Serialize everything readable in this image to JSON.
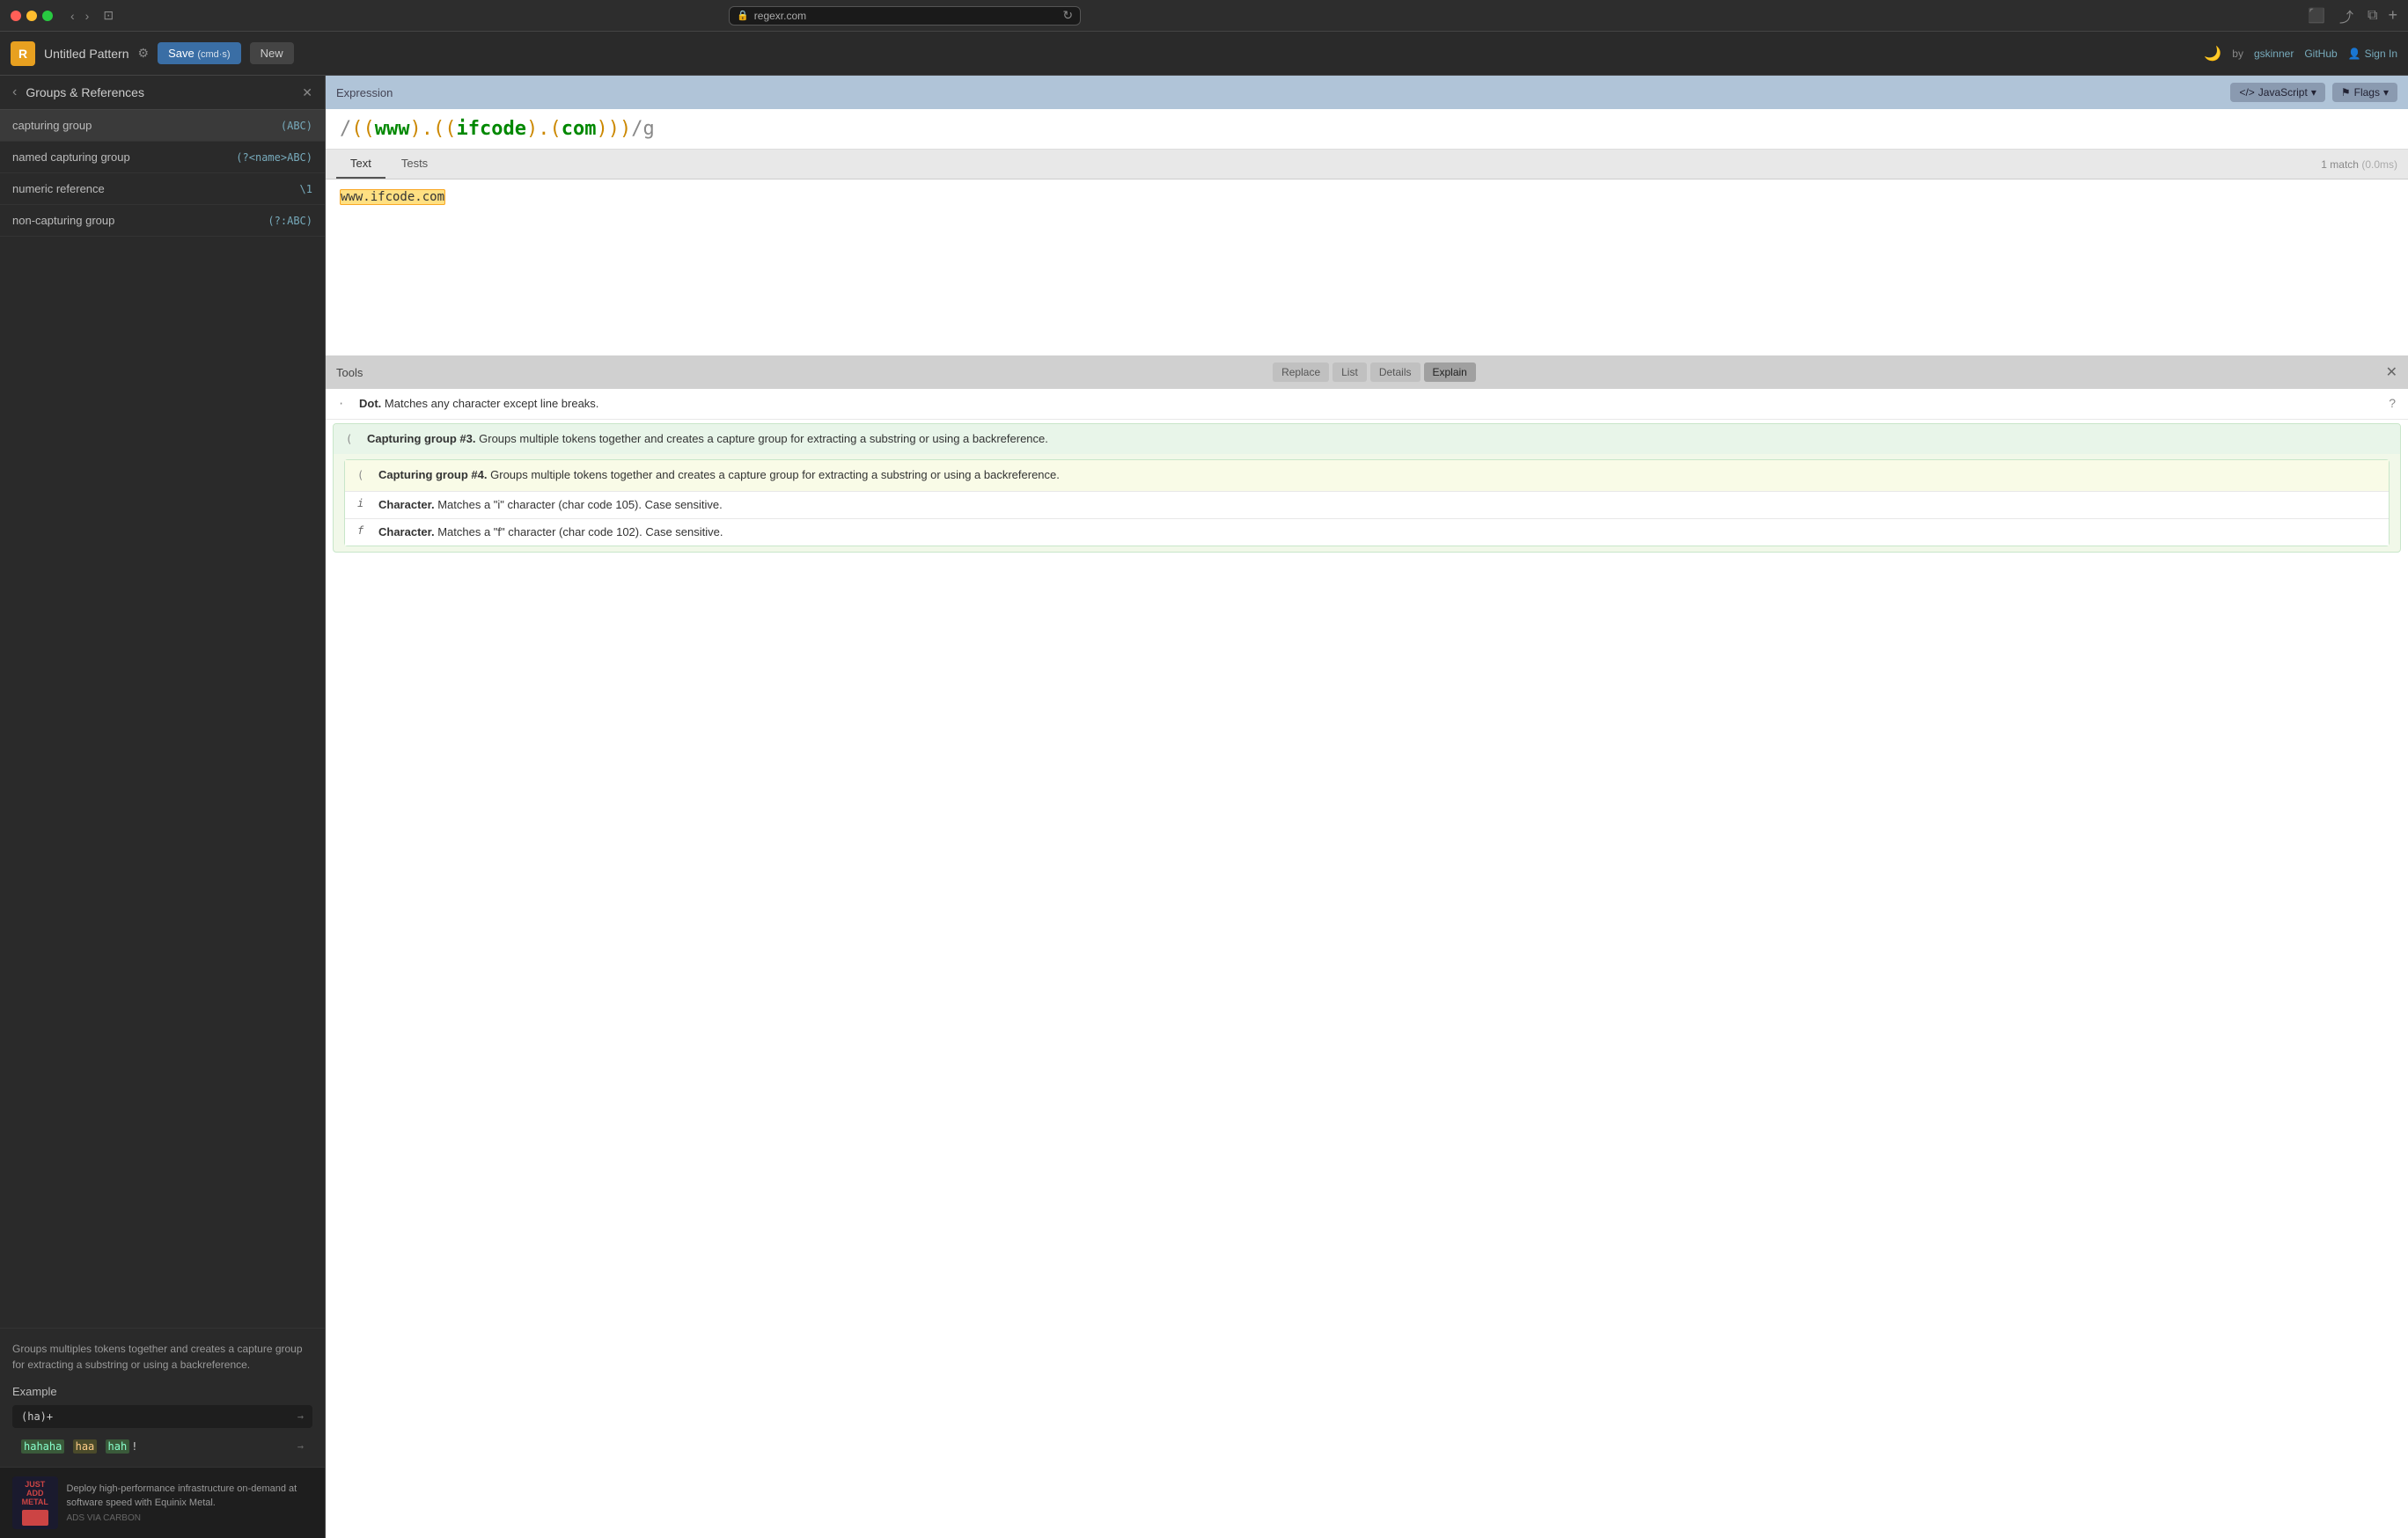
{
  "titlebar": {
    "url": "regexr.com",
    "lock_icon": "🔒"
  },
  "app_header": {
    "logo_text": "R",
    "pattern_title": "Untitled Pattern",
    "save_label": "Save",
    "save_shortcut": "(cmd·s)",
    "new_label": "New",
    "dark_mode_icon": "🌙",
    "by_text": "by",
    "gskinner_label": "gskinner",
    "github_label": "GitHub",
    "signin_label": "Sign In"
  },
  "sidebar": {
    "title": "Groups & References",
    "items": [
      {
        "name": "capturing group",
        "code": "(ABC)"
      },
      {
        "name": "named capturing group",
        "code": "(?<name>ABC)"
      },
      {
        "name": "numeric reference",
        "code": "\\1"
      },
      {
        "name": "non-capturing group",
        "code": "(?:ABC)"
      }
    ],
    "description": "Groups multiples tokens together and creates a capture group for extracting a substring or using a backreference.",
    "example_title": "Example",
    "example_code": "(ha)+",
    "example_matches_text": "hahaha  haa  hah!",
    "example_matches": [
      "hahaha",
      "haa",
      "hah"
    ],
    "ad_text": "Deploy high-performance infrastructure on-demand at software speed with Equinix Metal.",
    "ad_label": "ADS VIA CARBON"
  },
  "expression": {
    "label": "Expression",
    "language_label": "JavaScript",
    "flags_label": "Flags",
    "regex_parts": {
      "open_slash": "/",
      "open_paren1": "(",
      "open_paren2": "(",
      "www": "www",
      "close_paren1": ")",
      "dot": ".",
      "open_group": "(",
      "open_paren3": "(",
      "ifcode": "ifcode",
      "close_paren2": ")",
      "dot2": ".",
      "open_paren4": "(",
      "com": "com",
      "close_paren3": ")",
      "close_group": ")",
      "close_paren4": ")",
      "close_slash": "/",
      "flag": "g"
    },
    "full_regex": "/((www).((ifcode).(com)))/g"
  },
  "tabs": {
    "text_label": "Text",
    "tests_label": "Tests",
    "match_count": "1 match",
    "match_time": "(0.0ms)"
  },
  "text_content": {
    "matched_text": "www.ifcode.com",
    "placeholder": ""
  },
  "tools": {
    "label": "Tools",
    "tabs": [
      {
        "label": "Replace"
      },
      {
        "label": "List"
      },
      {
        "label": "Details"
      },
      {
        "label": "Explain"
      }
    ],
    "active_tab": "Explain",
    "explain_items": [
      {
        "type": "dot",
        "icon": "·",
        "text_strong": "Dot.",
        "text": " Matches any character except line breaks."
      },
      {
        "type": "group3",
        "icon": "(",
        "text_strong": "Capturing group #3.",
        "text": " Groups multiple tokens together and creates a capture group for extracting a substring or using a backreference.",
        "inner_group": {
          "icon": "(",
          "text_strong": "Capturing group #4.",
          "text": " Groups multiple tokens together and creates a capture group for extracting a substring or using a backreference.",
          "chars": [
            {
              "icon": "i",
              "text_strong": "Character.",
              "text": " Matches a \"i\" character (char code 105). Case sensitive."
            },
            {
              "icon": "f",
              "text_strong": "Character.",
              "text": " Matches a \"f\" character (char code 102). Case sensitive."
            }
          ]
        }
      }
    ]
  }
}
